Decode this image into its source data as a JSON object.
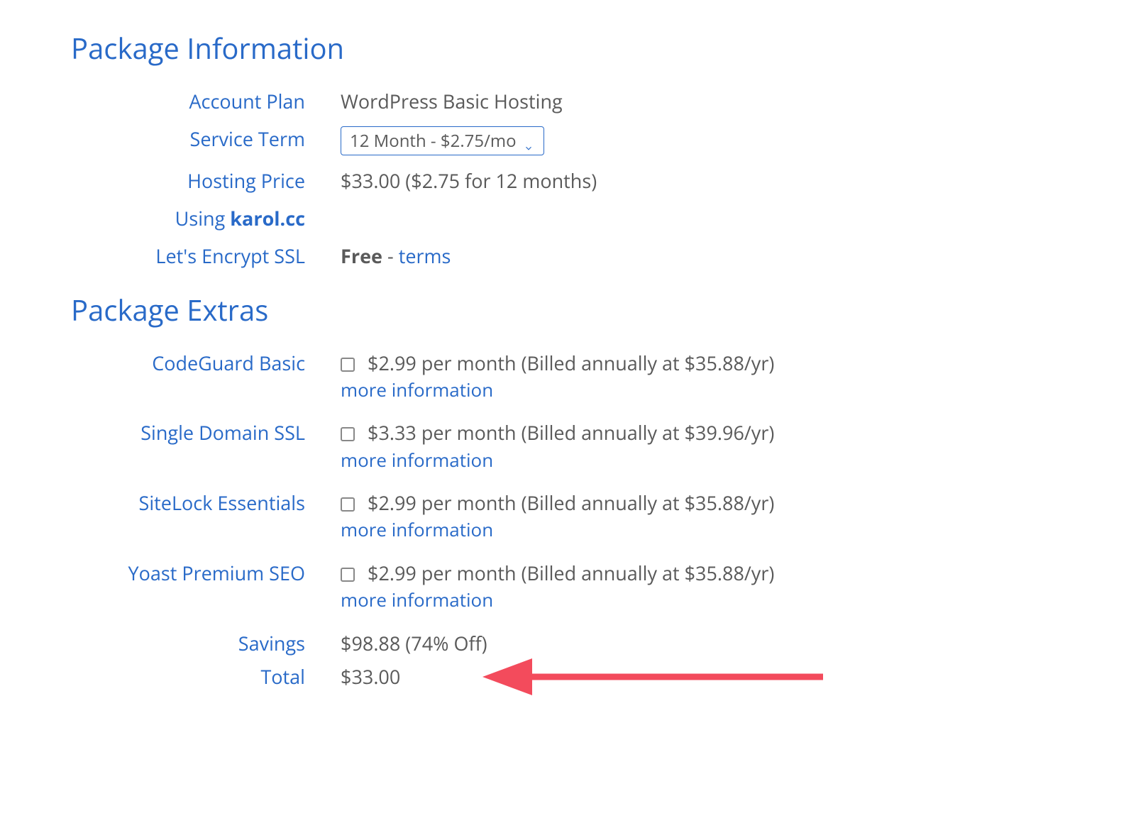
{
  "sections": {
    "info_title": "Package Information",
    "extras_title": "Package Extras"
  },
  "info": {
    "account_plan_label": "Account Plan",
    "account_plan_value": "WordPress Basic Hosting",
    "service_term_label": "Service Term",
    "service_term_selected": "12 Month - $2.75/mo",
    "hosting_price_label": "Hosting Price",
    "hosting_price_value": "$33.00 ($2.75 for 12 months)",
    "using_prefix": "Using ",
    "using_domain": "karol.cc",
    "ssl_label": "Let's Encrypt SSL",
    "ssl_free": "Free",
    "ssl_sep": " - ",
    "ssl_terms": "terms"
  },
  "extras": [
    {
      "name": "CodeGuard Basic",
      "price": "$2.99 per month (Billed annually at $35.88/yr)",
      "more": "more information"
    },
    {
      "name": "Single Domain SSL",
      "price": "$3.33 per month (Billed annually at $39.96/yr)",
      "more": "more information"
    },
    {
      "name": "SiteLock Essentials",
      "price": "$2.99 per month (Billed annually at $35.88/yr)",
      "more": "more information"
    },
    {
      "name": "Yoast Premium SEO",
      "price": "$2.99 per month (Billed annually at $35.88/yr)",
      "more": "more information"
    }
  ],
  "summary": {
    "savings_label": "Savings",
    "savings_value": "$98.88 (74% Off)",
    "total_label": "Total",
    "total_value": "$33.00"
  },
  "colors": {
    "brand": "#296ac8",
    "text": "#5a5a5a",
    "arrow": "#f34b5c"
  }
}
